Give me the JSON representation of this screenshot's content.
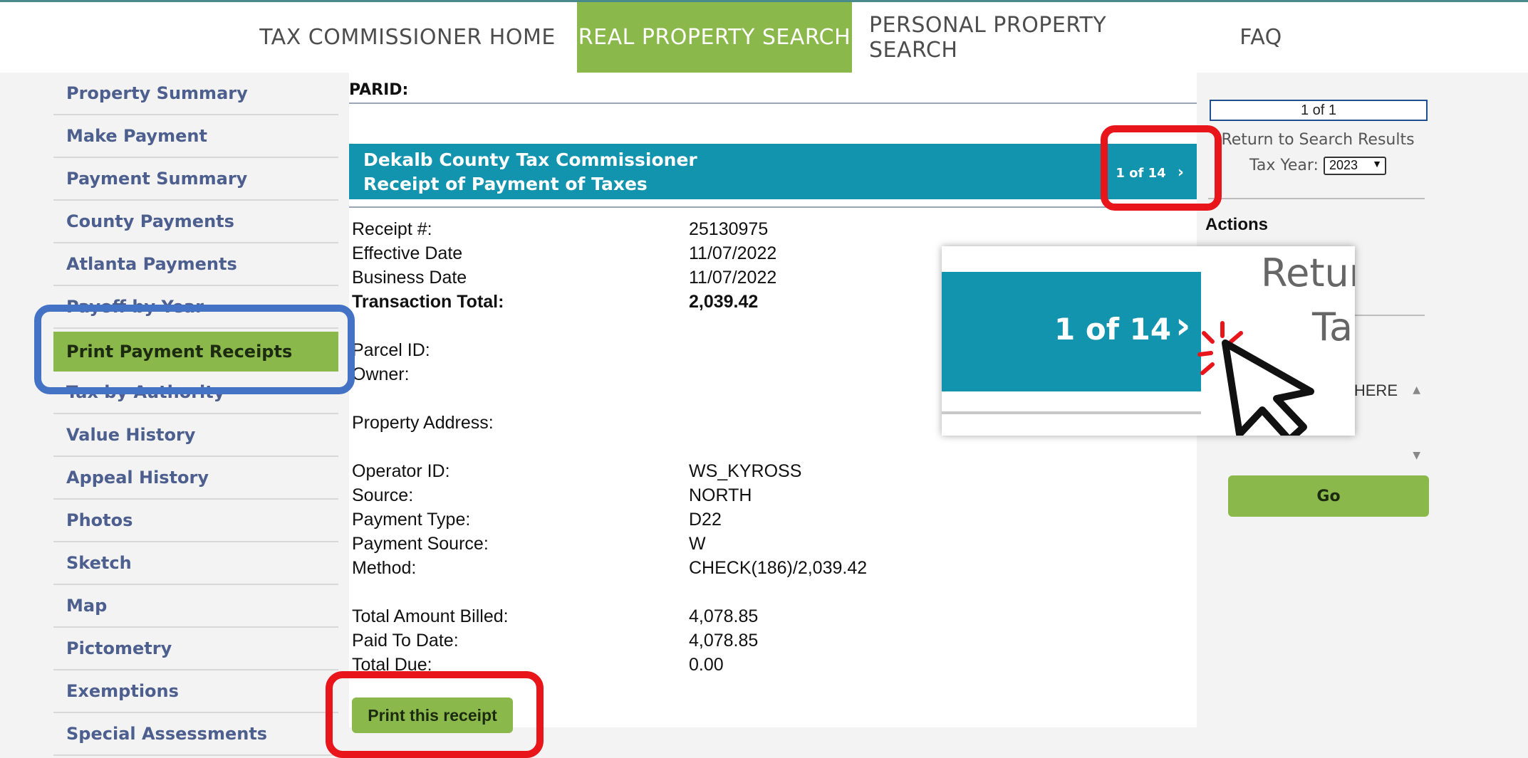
{
  "nav": {
    "items": [
      {
        "label": "TAX COMMISSIONER HOME"
      },
      {
        "label": "REAL PROPERTY SEARCH"
      },
      {
        "label": "PERSONAL PROPERTY SEARCH"
      },
      {
        "label": "FAQ"
      }
    ],
    "active_color": "#8ab84a"
  },
  "sidebar": {
    "items": [
      {
        "label": "Property Summary"
      },
      {
        "label": "Make Payment"
      },
      {
        "label": "Payment Summary"
      },
      {
        "label": "County Payments"
      },
      {
        "label": "Atlanta Payments"
      },
      {
        "label": "Payoff by Year"
      },
      {
        "label": "Print Payment Receipts"
      },
      {
        "label": "Tax by Authority"
      },
      {
        "label": "Value History"
      },
      {
        "label": "Appeal History"
      },
      {
        "label": "Photos"
      },
      {
        "label": "Sketch"
      },
      {
        "label": "Map"
      },
      {
        "label": "Pictometry"
      },
      {
        "label": "Exemptions"
      },
      {
        "label": "Special Assessments"
      }
    ],
    "active": "Print Payment Receipts"
  },
  "content": {
    "parid_label": "PARID:",
    "banner": {
      "line1": "Dekalb County Tax Commissioner",
      "line2": "Receipt of Payment of Taxes",
      "pager": "1 of 14",
      "color": "#1294ae"
    },
    "receipt": {
      "receipt_no_label": "Receipt #:",
      "receipt_no": "25130975",
      "effective_date_label": "Effective Date",
      "effective_date": "11/07/2022",
      "business_date_label": "Business Date",
      "business_date": "11/07/2022",
      "transaction_total_label": "Transaction Total:",
      "transaction_total": "2,039.42",
      "parcel_id_label": "Parcel ID:",
      "owner_label": "Owner:",
      "property_address_label": "Property Address:",
      "operator_id_label": "Operator ID:",
      "operator_id": "WS_KYROSS",
      "source_label": "Source:",
      "source": "NORTH",
      "payment_type_label": "Payment Type:",
      "payment_type": "D22",
      "payment_source_label": "Payment Source:",
      "payment_source": "W",
      "method_label": "Method:",
      "method": "CHECK(186)/2,039.42",
      "total_billed_label": "Total Amount Billed:",
      "total_billed": "4,078.85",
      "paid_to_date_label": "Paid To Date:",
      "paid_to_date": "4,078.85",
      "total_due_label": "Total Due:",
      "total_due": "0.00"
    },
    "print_button": "Print this receipt"
  },
  "right": {
    "pager": "1 of 1",
    "return_link": "Return to Search Results",
    "tax_year_label": "Tax Year:",
    "tax_year_value": "2023",
    "actions_heading": "Actions",
    "list_text": "HERE",
    "go_button": "Go"
  },
  "zoom": {
    "pager": "1 of 14",
    "return_partial": "Retur",
    "tax_partial": "Ta"
  },
  "highlight_colors": {
    "red": "#e8151b",
    "blue": "#4472c4"
  }
}
